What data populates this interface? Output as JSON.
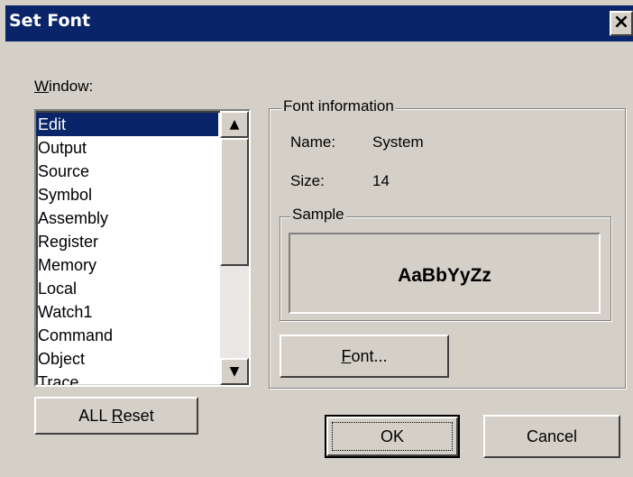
{
  "dialog": {
    "title": "Set Font",
    "close_glyph": "×"
  },
  "window_label_accel": "W",
  "window_label_rest": "indow:",
  "windows": [
    {
      "label": "Edit",
      "selected": true
    },
    {
      "label": "Output"
    },
    {
      "label": "Source"
    },
    {
      "label": "Symbol"
    },
    {
      "label": "Assembly"
    },
    {
      "label": "Register"
    },
    {
      "label": "Memory"
    },
    {
      "label": "Local"
    },
    {
      "label": "Watch1"
    },
    {
      "label": "Command"
    },
    {
      "label": "Object"
    },
    {
      "label": "Trace"
    }
  ],
  "font_info": {
    "group_label": "Font information",
    "name_label": "Name:",
    "name_value": "System",
    "size_label": "Size:",
    "size_value": "14",
    "sample_label": "Sample",
    "sample_text": "AaBbYyZz"
  },
  "buttons": {
    "font_accel": "F",
    "font_rest": "ont...",
    "reset_pre": "ALL ",
    "reset_accel": "R",
    "reset_rest": "eset",
    "ok": "OK",
    "cancel": "Cancel"
  },
  "icons": {
    "scroll_up": "▲",
    "scroll_down": "▼"
  }
}
